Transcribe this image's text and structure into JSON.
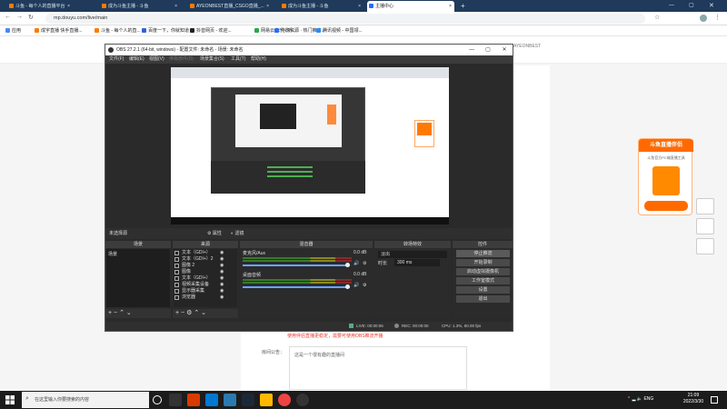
{
  "browser": {
    "tabs": [
      {
        "label": "斗鱼 - 每个人的直播平台"
      },
      {
        "label": "成为斗鱼主播 - 斗鱼"
      },
      {
        "label": "AYEONBEST直播_CSGO直播_..."
      },
      {
        "label": "成为斗鱼主播 - 斗鱼"
      },
      {
        "label": "主播中心"
      }
    ],
    "new_tab": "+",
    "url": "mp.douyu.com/live/main",
    "bookmarks": [
      "应用",
      "成宇直播 快手直播...",
      "斗鱼 - 每个人的直...",
      "百度一下，你就知道",
      "抖音网页 - 欢迎...",
      "网易云音乐 - 听...",
      "电影资源 · 热门推荐...",
      "腾讯视频 - 中国领..."
    ]
  },
  "douyu": {
    "user": "AYEONBEST",
    "promo_title": "斗鱼直播伴侣",
    "promo_sub": "斗鱼官方PC端直播工具",
    "notice": "使用伴侣直播更稳定，需要可使用OBS推流开播",
    "announce_label": "房间公告：",
    "announce_text": "这是一个很有趣的直播间"
  },
  "obs": {
    "title": "OBS 27.2.1 (64-bit, windows) - 配置文件: 未命名 - 场景: 未命名",
    "menu": [
      "文件(F)",
      "编辑(E)",
      "视图(V)",
      "停靠部件(D)",
      "场景集合(S)",
      "工具(T)",
      "帮助(H)"
    ],
    "no_source_selected": "未选择源",
    "properties_btn": "属性",
    "filters_btn": "滤镜",
    "panels": {
      "scenes": "场景",
      "sources": "来源",
      "mixer": "混音器",
      "transitions": "转场特效",
      "controls": "控件"
    },
    "scenes": [
      "场景"
    ],
    "sources": [
      "文本（GDI+）",
      "文本（GDI+）2",
      "图像 2",
      "图像",
      "文本（GDI+）",
      "视频采集设备",
      "显示器采集",
      "浏览器"
    ],
    "mixer": [
      {
        "name": "麦克风/Aux",
        "db": "0.0 dB"
      },
      {
        "name": "桌面音频",
        "db": "0.0 dB"
      }
    ],
    "transition": {
      "type": "淡出",
      "duration_label": "时长",
      "duration": "300 ms"
    },
    "controls": [
      "停止推流",
      "开始录制",
      "启动虚拟摄像机",
      "工作室模式",
      "设置",
      "退出"
    ],
    "status": {
      "live": "LIVE: 00:00:06",
      "rec": "REC: 00:00:00",
      "cpu": "CPU: 1.3%, 60.00 fps"
    }
  },
  "taskbar": {
    "search_placeholder": "在这里输入你要搜索的内容",
    "time": "21:09",
    "date": "2022/3/30",
    "lang": "ENG"
  }
}
